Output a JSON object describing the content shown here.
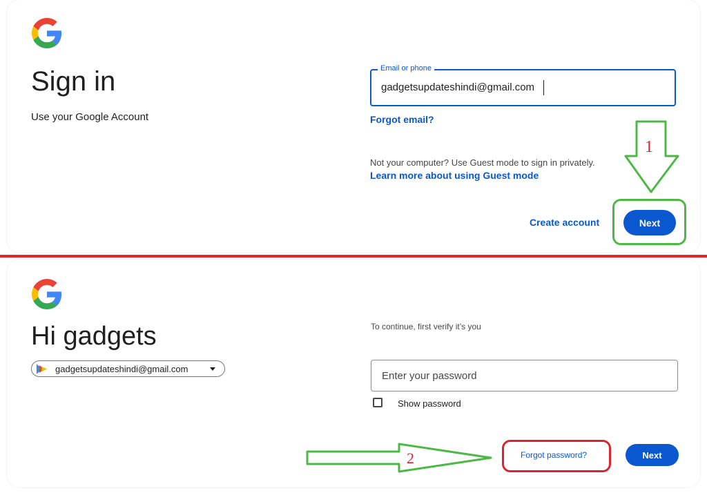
{
  "top_panel": {
    "title": "Sign in",
    "subtitle": "Use your Google Account",
    "email_field": {
      "label": "Email or phone",
      "value": "gadgetsupdateshindi@gmail.com"
    },
    "forgot_email": "Forgot email?",
    "guest_notice": "Not your computer? Use Guest mode to sign in privately.",
    "guest_link": "Learn more about using Guest mode",
    "create_account": "Create account",
    "next_label": "Next"
  },
  "bottom_panel": {
    "title": "Hi gadgets",
    "account_chip": "gadgetsupdateshindi@gmail.com",
    "verify_text": "To continue, first verify it’s you",
    "password_field": {
      "placeholder": "Enter your password"
    },
    "show_password": "Show password",
    "forgot_password": "Forgot password?",
    "next_label": "Next"
  },
  "annotations": {
    "step1": "1",
    "step2": "2",
    "arrow_color": "#4cb944",
    "highlight_red": "#d9252f"
  },
  "colors": {
    "accent": "#0b57d0",
    "divider": "#e3262f"
  },
  "icons": [
    "google-logo-icon",
    "account-avatar-icon",
    "chevron-down-icon",
    "arrow-down-icon",
    "arrow-right-icon"
  ]
}
